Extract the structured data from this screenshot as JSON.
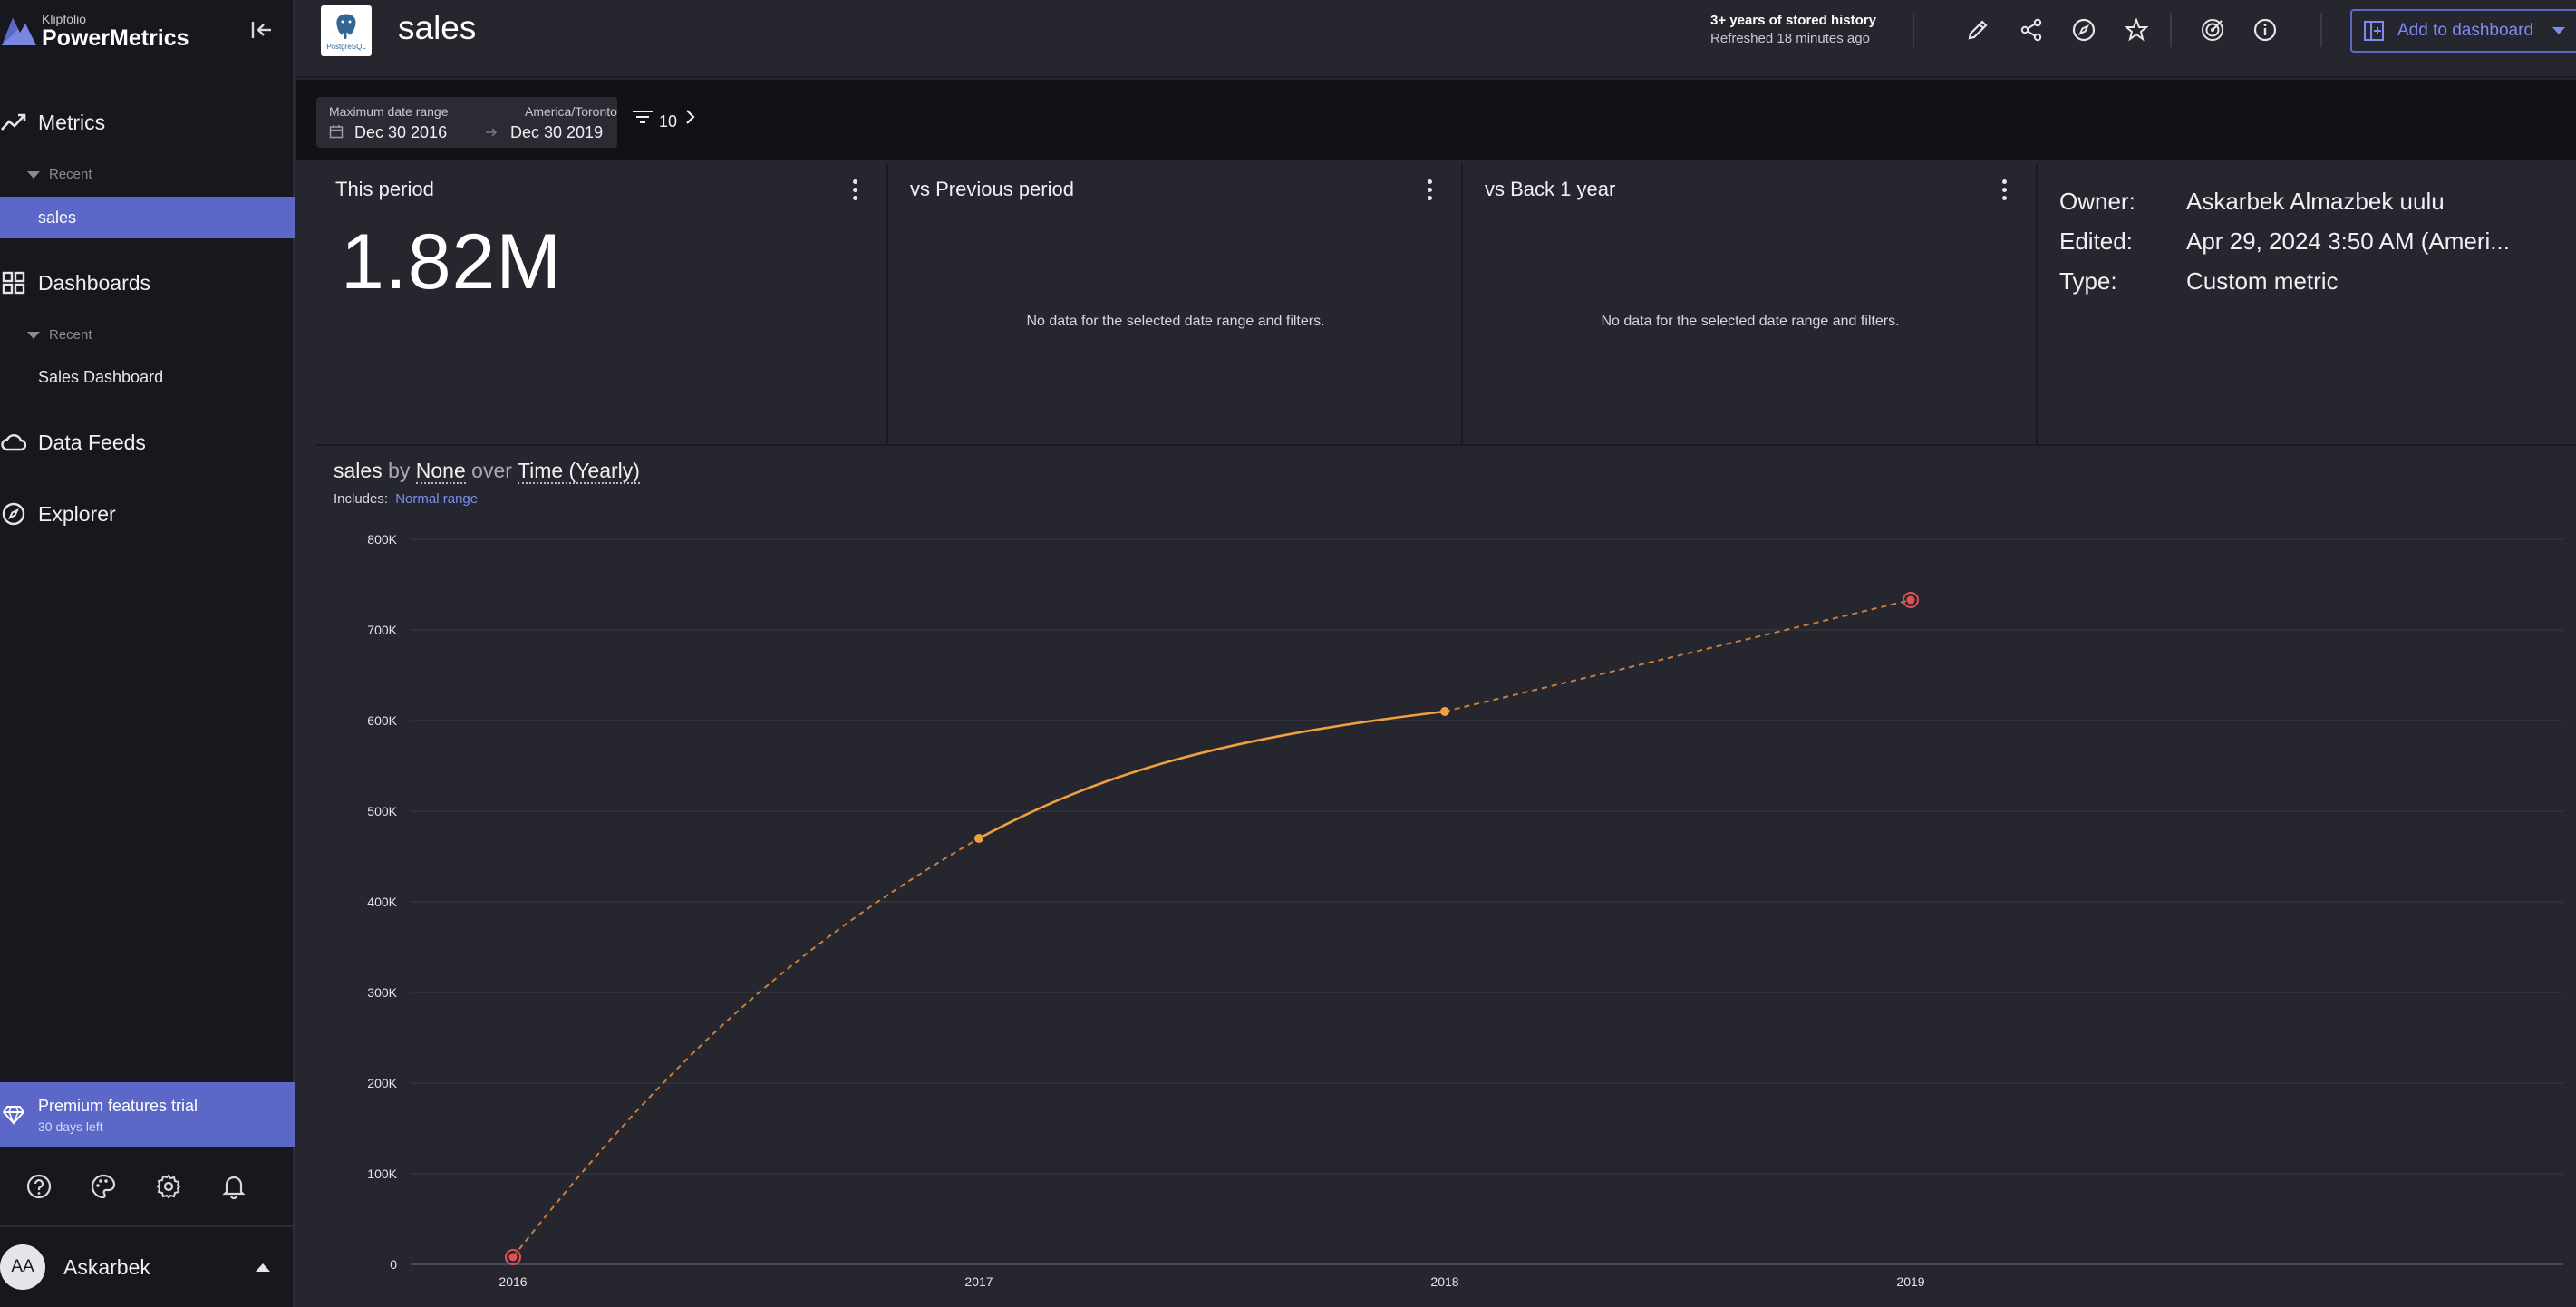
{
  "sidebar": {
    "logo_small": "Klipfolio",
    "logo_big": "PowerMetrics",
    "metrics_label": "Metrics",
    "metrics_recent_label": "Recent",
    "metrics_recent_item": "sales",
    "dashboards_label": "Dashboards",
    "dashboards_recent_label": "Recent",
    "dashboards_recent_item": "Sales Dashboard",
    "datafeeds_label": "Data Feeds",
    "explorer_label": "Explorer",
    "premium_title": "Premium features trial",
    "premium_sub": "30 days left",
    "user_initials": "AA",
    "user_name": "Askarbek"
  },
  "header": {
    "title": "sales",
    "db_logo_caption": "PostgreSQL",
    "history_title": "3+ years of stored history",
    "history_sub": "Refreshed 18 minutes ago",
    "add_button": "Add to dashboard"
  },
  "filters": {
    "range_label": "Maximum date range",
    "timezone": "America/Toronto",
    "date_from": "Dec 30 2016",
    "date_to": "Dec 30 2019",
    "filter_count": "10"
  },
  "panels": {
    "this_period_title": "This period",
    "this_period_value": "1.82M",
    "vs_prev_title": "vs Previous period",
    "vs_prev_msg": "No data for the selected date range and filters.",
    "vs_year_title": "vs Back 1 year",
    "vs_year_msg": "No data for the selected date range and filters.",
    "owner_key": "Owner:",
    "owner_val": "Askarbek Almazbek uulu",
    "edited_key": "Edited:",
    "edited_val": "Apr 29, 2024 3:50 AM (Ameri...",
    "type_key": "Type:",
    "type_val": "Custom metric"
  },
  "chart_heading": {
    "metric": "sales",
    "by": "by",
    "dimension": "None",
    "over": "over",
    "time": "Time (Yearly)",
    "includes_label": "Includes:",
    "includes_link": "Normal range"
  },
  "colors": {
    "accent": "#5b68c8",
    "line": "#f0a040",
    "endpoint": "#e05050"
  },
  "chart_data": {
    "type": "line",
    "x": [
      "2016",
      "2017",
      "2018",
      "2019"
    ],
    "values": [
      8000,
      470000,
      610000,
      733000
    ],
    "ylim": [
      0,
      800000
    ],
    "yticks": [
      "0",
      "100K",
      "200K",
      "300K",
      "400K",
      "500K",
      "600K",
      "700K",
      "800K"
    ],
    "grid": true,
    "legend": "none"
  }
}
